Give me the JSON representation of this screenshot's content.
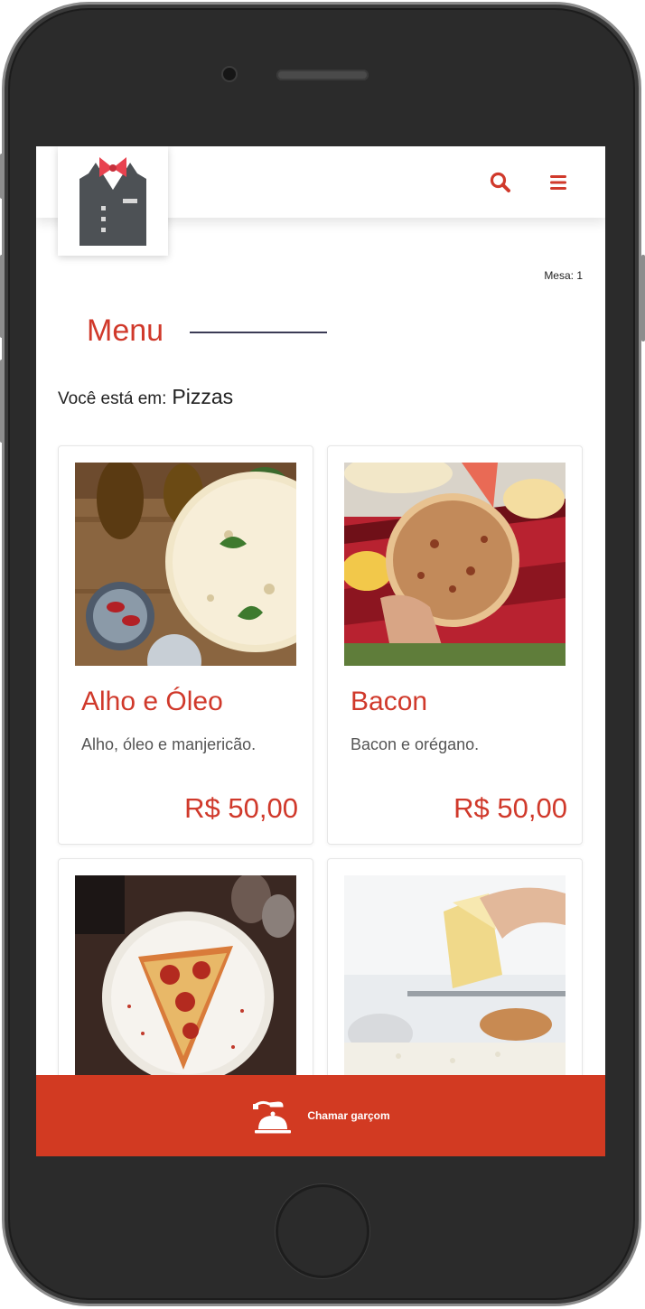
{
  "header": {
    "logo_icon": "waiter-vest-icon",
    "search_icon": "search-icon",
    "menu_icon": "hamburger-menu-icon",
    "accent_color": "#d0392b"
  },
  "table_info": "Mesa: 1",
  "page": {
    "title": "Menu",
    "breadcrumb_prefix": "Você está em:",
    "breadcrumb_category": "Pizzas"
  },
  "products": [
    {
      "name": "Alho e Óleo",
      "description": "Alho, óleo e manjericão.",
      "price": "R$ 50,00",
      "image": "pizza-photo"
    },
    {
      "name": "Bacon",
      "description": "Bacon e orégano.",
      "price": "R$ 50,00",
      "image": "pizza-photo"
    },
    {
      "name": "",
      "description": "",
      "price": "",
      "image": "pepperoni-slice-photo"
    },
    {
      "name": "",
      "description": "",
      "price": "",
      "image": "cheese-grating-photo"
    }
  ],
  "call_waiter": {
    "label": "Chamar garçom",
    "icon": "service-bell-icon",
    "color": "#d23a22"
  }
}
